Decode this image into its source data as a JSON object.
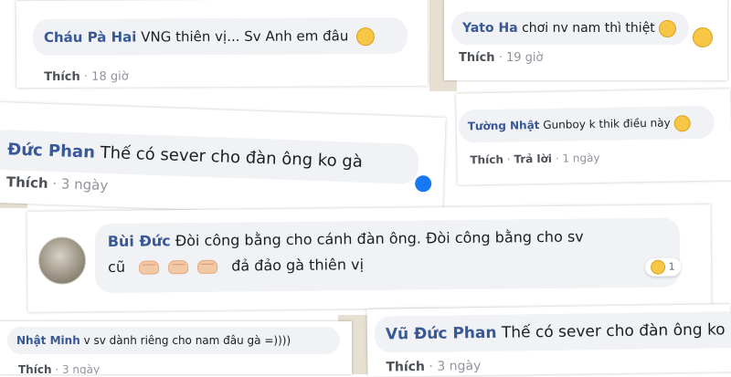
{
  "comments": [
    {
      "id": "chau-pa-hai",
      "author": "Cháu Pà Hai",
      "text": "VNG thiên vị... Sv Anh em đâu",
      "emoji": "neutral-face",
      "actions": [
        "Thích",
        "·",
        "18 giờ"
      ]
    },
    {
      "id": "yato-ha",
      "author": "Yato Ha",
      "text": "chơi nv nam thì thiệt",
      "emoji": "laughing-tears-face",
      "reaction": "tongue-out-face",
      "actions": [
        "Thích",
        "·",
        "19 giờ"
      ]
    },
    {
      "id": "vu-duc-phan-1",
      "author": "Đức Phan",
      "text": "Thế có sever cho đàn ông ko gà",
      "reaction": "like-icon",
      "actions": [
        "Thích",
        "·",
        "3 ngày"
      ]
    },
    {
      "id": "tuong-nhat",
      "author": "Tường Nhật",
      "text": "Gunboy k thik điều này",
      "emoji": "smiling-face",
      "actions": [
        "Thích",
        "·",
        "Trả lời",
        "·",
        "1 ngày"
      ]
    },
    {
      "id": "bui-duc",
      "author": "Bùi Đức",
      "text_line1": "Đòi công bằng cho cánh đàn ông. Đòi công bằng cho sv",
      "text_line2": "cũ",
      "text_line2b": "đả đảo gà thiên vị",
      "reaction": "laughing-face",
      "reaction_count": "1"
    },
    {
      "id": "nhat-minh",
      "author": "Nhật Minh",
      "text": "v sv dành riêng cho nam đâu gà =))))",
      "actions": [
        "Thích",
        "·",
        "3 ngày"
      ]
    },
    {
      "id": "vu-duc-phan-2",
      "author": "Vũ Đức Phan",
      "text": "Thế có sever cho đàn ông ko",
      "actions": [
        "Thích",
        "·",
        "3 ngày"
      ]
    }
  ]
}
